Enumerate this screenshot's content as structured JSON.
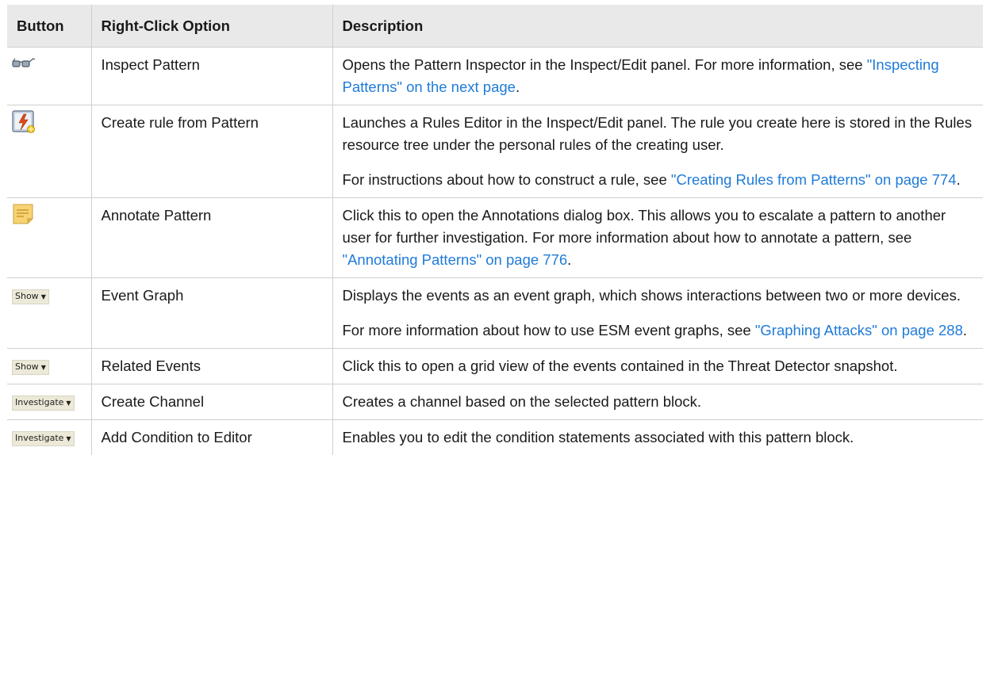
{
  "table": {
    "headers": [
      "Button",
      "Right-Click Option",
      "Description"
    ],
    "rows": [
      {
        "button": {
          "type": "icon",
          "icon": "glasses-icon"
        },
        "option": "Inspect Pattern",
        "paragraphs": [
          [
            {
              "text": "Opens the Pattern Inspector in the Inspect/Edit panel. For more information, see "
            },
            {
              "text": "\"Inspecting Patterns\" on the next page",
              "link": true
            },
            {
              "text": "."
            }
          ]
        ]
      },
      {
        "button": {
          "type": "icon",
          "icon": "rule-lightning-icon"
        },
        "option": "Create rule from Pattern",
        "paragraphs": [
          [
            {
              "text": "Launches a Rules Editor in the Inspect/Edit panel. The rule you create here is stored in the Rules resource tree under the personal rules of the creating user."
            }
          ],
          [
            {
              "text": "For instructions about how to construct a rule, see "
            },
            {
              "text": "\"Creating Rules from Patterns\" on page 774",
              "link": true
            },
            {
              "text": "."
            }
          ]
        ]
      },
      {
        "button": {
          "type": "icon",
          "icon": "sticky-note-icon"
        },
        "option": "Annotate Pattern",
        "paragraphs": [
          [
            {
              "text": "Click this to open the Annotations dialog box. This allows you to escalate a pattern to another user for further investigation. For more information about how to annotate a pattern, see "
            },
            {
              "text": "\"Annotating Patterns\" on page 776",
              "link": true
            },
            {
              "text": "."
            }
          ]
        ]
      },
      {
        "button": {
          "type": "dropdown",
          "label": "Show"
        },
        "option": "Event Graph",
        "paragraphs": [
          [
            {
              "text": "Displays the events as an event graph, which shows interactions between two or more devices."
            }
          ],
          [
            {
              "text": "For more information about how to use ESM event graphs, see "
            },
            {
              "text": "\"Graphing Attacks\" on page 288",
              "link": true
            },
            {
              "text": "."
            }
          ]
        ]
      },
      {
        "button": {
          "type": "dropdown",
          "label": "Show"
        },
        "option": "Related Events",
        "paragraphs": [
          [
            {
              "text": "Click this to open a grid view of the events contained in the Threat Detector snapshot."
            }
          ]
        ]
      },
      {
        "button": {
          "type": "dropdown",
          "label": "Investigate"
        },
        "option": "Create Channel",
        "paragraphs": [
          [
            {
              "text": "Creates a channel based on the selected pattern block."
            }
          ]
        ]
      },
      {
        "button": {
          "type": "dropdown",
          "label": "Investigate"
        },
        "option": "Add Condition to Editor",
        "paragraphs": [
          [
            {
              "text": "Enables you to edit the condition statements associated with this pattern block."
            }
          ]
        ]
      }
    ]
  },
  "colors": {
    "header_bg": "#e9e9e9",
    "link": "#1f7bd8",
    "border": "#cfcfcf"
  }
}
